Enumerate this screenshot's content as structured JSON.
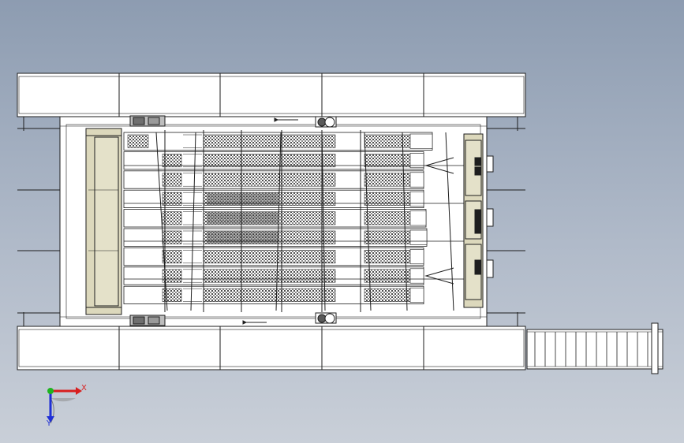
{
  "drawing": {
    "name": "",
    "colors": {
      "background_top": "#8d9cb1",
      "background_bottom": "#c9cfd8",
      "line": "#1e1e1e",
      "panel_fill": "#ffffff",
      "end_panel_fill": "#dcd8bc",
      "mesh": "#5a5a5a",
      "axis_x": "#d81e1e",
      "axis_y": "#1f2fd6",
      "axis_z": "#1fb41f"
    }
  },
  "triad": {
    "x_label": "X",
    "y_label": "Y",
    "x_color": "#d81e1e",
    "y_color": "#1f2fd6",
    "origin_color": "#1fb41f"
  }
}
